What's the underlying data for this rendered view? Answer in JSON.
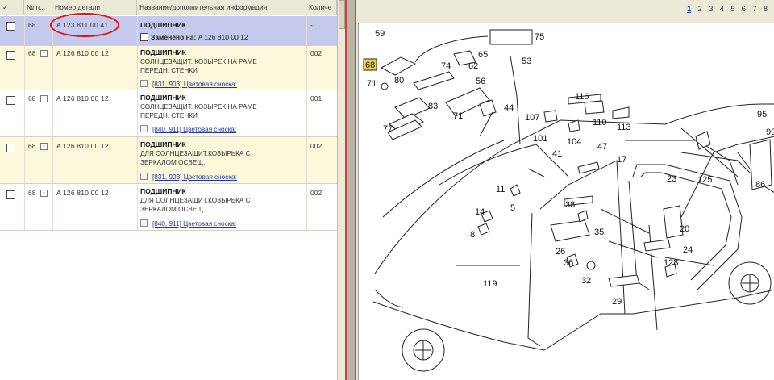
{
  "table": {
    "headers": {
      "check": "✓",
      "position": "№ п...",
      "part_number": "Номер детали",
      "name": "Название/дополнительная информация",
      "quantity": "Количе"
    },
    "rows": [
      {
        "position": "68",
        "part_number": "A 123 811 00 41",
        "name": "ПОДШИПНИК",
        "replaced_label": "Заменено на:",
        "replaced_value": "A 126 810 00 12",
        "quantity": "-"
      },
      {
        "position": "68",
        "part_number": "A 126 810 00 12",
        "name": "ПОДШИПНИК",
        "desc1": "СОЛНЦЕЗАЩИТ. КОЗЫРЕК НА РАМЕ",
        "desc2": "ПЕРЕДН. СТЕНКИ",
        "note": "[831, 903] Цветовая сноска:",
        "quantity": "002"
      },
      {
        "position": "68",
        "part_number": "A 126 810 00 12",
        "name": "ПОДШИПНИК",
        "desc1": "СОЛНЦЕЗАЩИТ. КОЗЫРЕК НА РАМЕ",
        "desc2": "ПЕРЕДН. СТЕНКИ",
        "note": "[840, 911] Цветовая сноска:",
        "quantity": "001"
      },
      {
        "position": "68",
        "part_number": "A 126 810 00 12",
        "name": "ПОДШИПНИК",
        "desc1": "ДЛЯ СОЛНЦЕЗАЩИТ.КОЗЫРЬКА С",
        "desc2": "ЗЕРКАЛОМ ОСВЕЩ.",
        "note": "[831, 903] Цветовая сноска:",
        "quantity": "002"
      },
      {
        "position": "68",
        "part_number": "A 126 810 00 12",
        "name": "ПОДШИПНИК",
        "desc1": "ДЛЯ СОЛНЦЕЗАЩИТ.КОЗЫРЬКА С",
        "desc2": "ЗЕРКАЛОМ ОСВЕЩ.",
        "note": "[840, 911] Цветовая сноска:",
        "quantity": "002"
      }
    ]
  },
  "pager": {
    "current": "1",
    "pages": [
      "2",
      "3",
      "4",
      "5",
      "6",
      "7",
      "8"
    ]
  },
  "diagram": {
    "highlighted_label": "68",
    "labels": {
      "l59": "59",
      "l75": "75",
      "l65": "65",
      "l74": "74",
      "l62": "62",
      "l53": "53",
      "l56": "56",
      "l71a": "71",
      "l80": "80",
      "l83": "83",
      "l77": "77",
      "l71b": "71",
      "l44": "44",
      "l116": "116",
      "l107": "107",
      "l110": "110",
      "l113": "113",
      "l101": "101",
      "l104": "104",
      "l95": "95",
      "l99": "99",
      "l47": "47",
      "l41": "41",
      "l17": "17",
      "l125": "125",
      "l86": "86",
      "l11": "11",
      "l23": "23",
      "l38": "38",
      "l14": "14",
      "l5": "5",
      "l35": "35",
      "l8": "8",
      "l20": "20",
      "l26": "26",
      "l24": "24",
      "l36": "36",
      "l128": "128",
      "l32": "32",
      "l119": "119",
      "l29": "29"
    }
  }
}
